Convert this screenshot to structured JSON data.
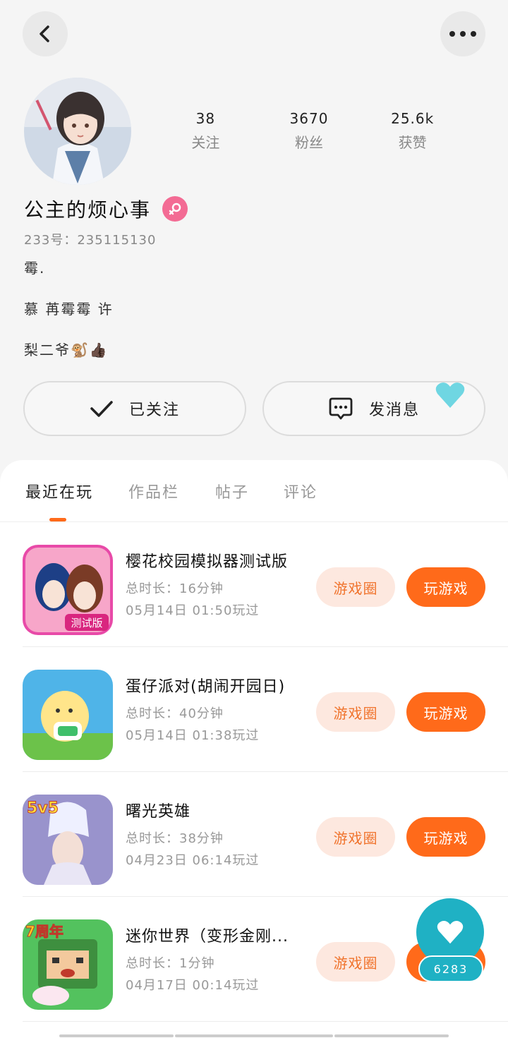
{
  "profile": {
    "name": "公主的烦心事",
    "uid": "233号：235115130",
    "bio_lines": [
      "霉.",
      "慕 苒霉霉 许",
      "梨二爷🐒👍🏿"
    ],
    "stats": [
      {
        "value": "38",
        "label": "关注"
      },
      {
        "value": "3670",
        "label": "粉丝"
      },
      {
        "value": "25.6k",
        "label": "获赞"
      }
    ]
  },
  "actions": {
    "follow_label": "已关注",
    "message_label": "发消息"
  },
  "tabs": [
    "最近在玩",
    "作品栏",
    "帖子",
    "评论"
  ],
  "games": [
    {
      "name": "樱花校园模拟器测试版",
      "duration": "总时长：16分钟",
      "last_played": "05月14日 01:50玩过",
      "circle_label": "游戏圈",
      "play_label": "玩游戏"
    },
    {
      "name": "蛋仔派对(胡闹开园日)",
      "duration": "总时长：40分钟",
      "last_played": "05月14日 01:38玩过",
      "circle_label": "游戏圈",
      "play_label": "玩游戏"
    },
    {
      "name": "曙光英雄",
      "duration": "总时长：38分钟",
      "last_played": "04月23日 06:14玩过",
      "circle_label": "游戏圈",
      "play_label": "玩游戏"
    },
    {
      "name": "迷你世界（变形金刚...",
      "duration": "总时长：1分钟",
      "last_played": "04月17日 00:14玩过",
      "circle_label": "游戏圈",
      "play_label": "玩游戏"
    }
  ],
  "float_widget": {
    "count": "6283"
  },
  "colors": {
    "accent": "#ff6a1a",
    "gender_badge": "#f36b94",
    "float": "#1fb1c4"
  },
  "icons": {
    "back": "chevron-left-icon",
    "more": "more-dots-icon",
    "check": "check-icon",
    "message": "chat-bubble-icon",
    "heart": "heart-icon",
    "gender": "female-icon"
  }
}
